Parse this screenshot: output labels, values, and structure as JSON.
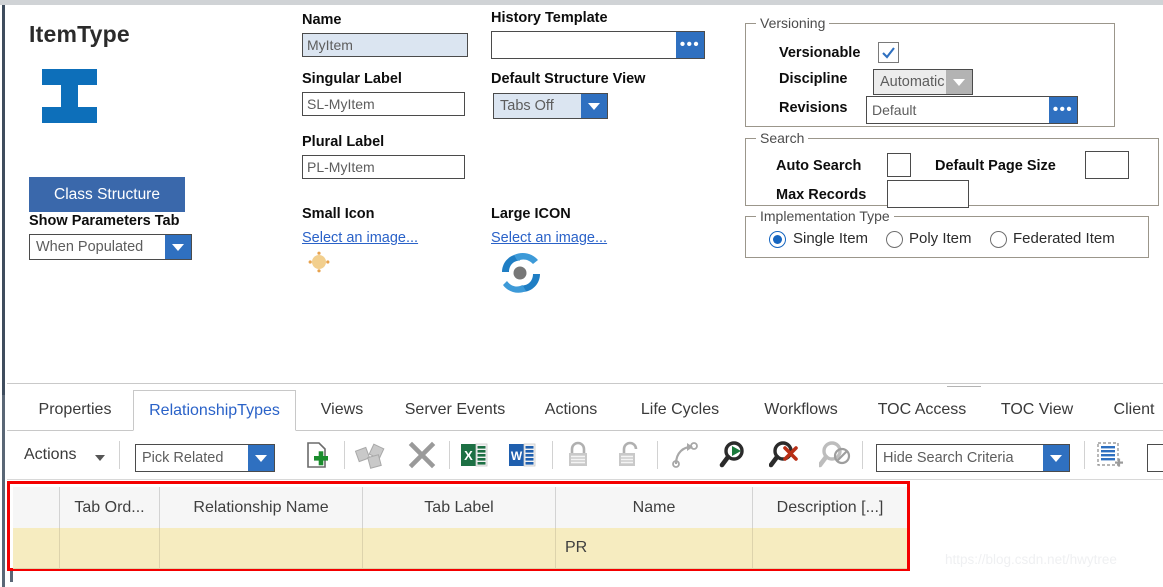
{
  "window": {
    "title": "ItemType"
  },
  "left_panel": {
    "title": "ItemType",
    "type_icon": "i-beam-icon",
    "class_structure_button": "Class Structure",
    "show_parameters_label": "Show Parameters Tab",
    "show_parameters_value": "When Populated"
  },
  "fields": {
    "name_label": "Name",
    "name_value": "MyItem",
    "singular_label": "Singular Label",
    "singular_value": "SL-MyItem",
    "plural_label": "Plural Label",
    "plural_value": "PL-MyItem",
    "history_template_label": "History Template",
    "history_template_value": "",
    "default_structure_view_label": "Default Structure View",
    "default_structure_view_value": "Tabs Off",
    "small_icon_label": "Small Icon",
    "small_icon_link": "Select an image...",
    "large_icon_label": "Large ICON",
    "large_icon_link": "Select an image..."
  },
  "versioning": {
    "caption": "Versioning",
    "versionable_label": "Versionable",
    "versionable_checked": true,
    "discipline_label": "Discipline",
    "discipline_value": "Automatic",
    "revisions_label": "Revisions",
    "revisions_value": "Default"
  },
  "search": {
    "caption": "Search",
    "auto_search_label": "Auto Search",
    "auto_search_checked": false,
    "default_page_size_label": "Default Page Size",
    "default_page_size_value": "",
    "max_records_label": "Max Records",
    "max_records_value": ""
  },
  "implementation": {
    "caption": "Implementation Type",
    "options": [
      {
        "label": "Single Item",
        "selected": true
      },
      {
        "label": "Poly Item",
        "selected": false
      },
      {
        "label": "Federated Item",
        "selected": false
      }
    ]
  },
  "tabs": [
    {
      "label": "Properties",
      "active": false
    },
    {
      "label": "RelationshipTypes",
      "active": true
    },
    {
      "label": "Views",
      "active": false
    },
    {
      "label": "Server Events",
      "active": false
    },
    {
      "label": "Actions",
      "active": false
    },
    {
      "label": "Life Cycles",
      "active": false
    },
    {
      "label": "Workflows",
      "active": false
    },
    {
      "label": "TOC Access",
      "active": false
    },
    {
      "label": "TOC View",
      "active": false
    },
    {
      "label": "Client",
      "active": false
    }
  ],
  "toolbar": {
    "actions_label": "Actions",
    "pick_related_value": "Pick Related",
    "hide_search_criteria_value": "Hide Search Criteria",
    "icons": [
      "new-relationship-icon",
      "edit-relationship-icon",
      "delete-icon",
      "export-excel-icon",
      "export-word-icon",
      "lock-icon",
      "unlock-icon",
      "redo-icon",
      "run-search-icon",
      "clear-search-icon",
      "disabled-search-icon",
      "new-row-icon"
    ]
  },
  "grid": {
    "columns": [
      "",
      "Tab Ord...",
      "Relationship Name",
      "Tab Label",
      "Name",
      "Description [...]"
    ],
    "rows": [
      {
        "cells": [
          "",
          "",
          "",
          "",
          "PR",
          ""
        ]
      }
    ]
  },
  "watermark": "https://blog.csdn.net/hwytree",
  "colors": {
    "accent_blue": "#2f70c0",
    "link_blue": "#2a62c8",
    "button_blue": "#3a68ab",
    "highlight_red": "#f40000",
    "row_yellow": "#f6ecc0",
    "field_highlight": "#dbe5f1"
  }
}
